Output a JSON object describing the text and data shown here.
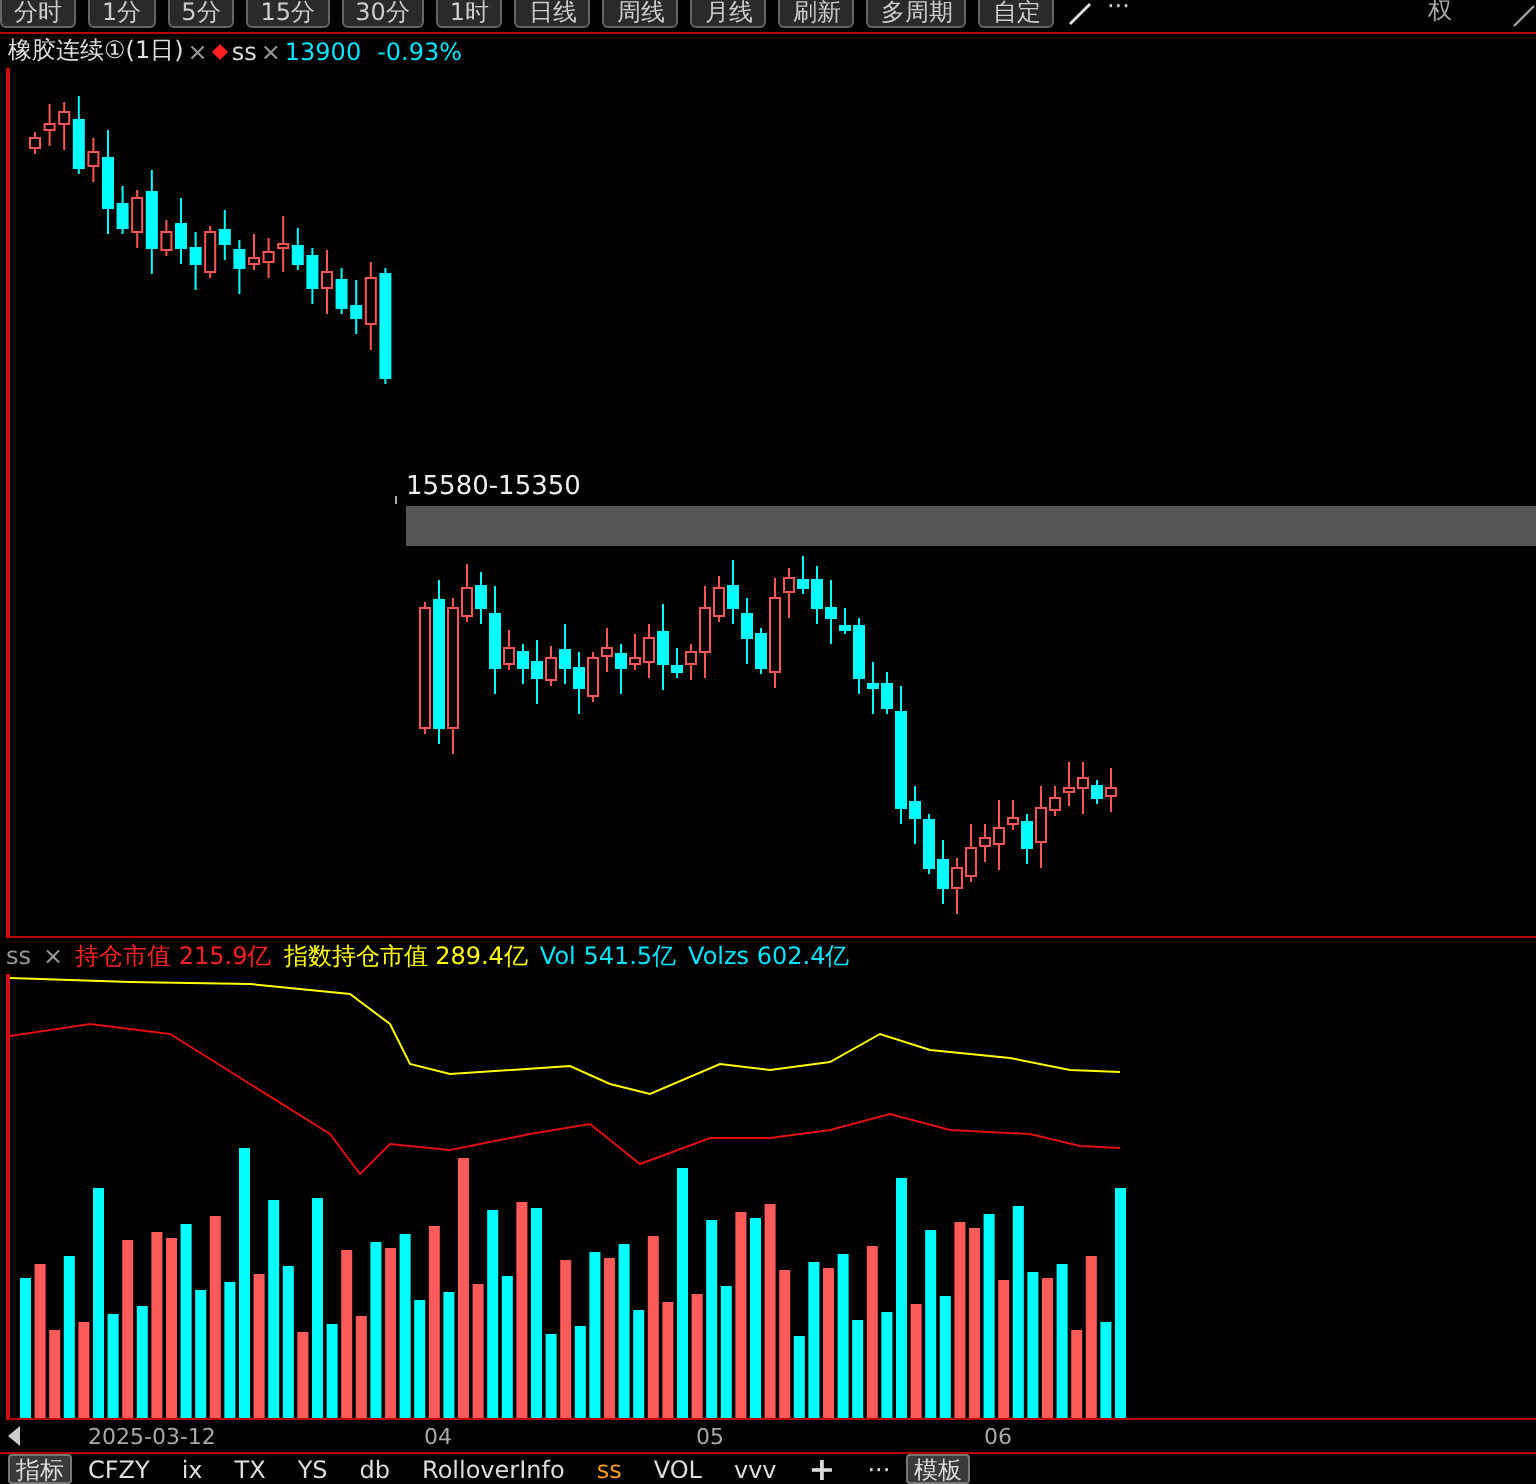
{
  "toolbar": {
    "buttons": [
      {
        "label": "分时"
      },
      {
        "label": "1分"
      },
      {
        "label": "5分"
      },
      {
        "label": "15分"
      },
      {
        "label": "30分"
      },
      {
        "label": "1时"
      },
      {
        "label": "日线"
      },
      {
        "label": "周线"
      },
      {
        "label": "月线"
      },
      {
        "label": "刷新"
      },
      {
        "label": "多周期"
      },
      {
        "label": "自定"
      }
    ],
    "more": "···",
    "right_label": "权"
  },
  "title": {
    "instrument": "橡胶连续①(1日)",
    "separator": "×",
    "series": "ss",
    "separator_2": "×",
    "price": "13900",
    "change": "-0.93%"
  },
  "zone": {
    "label": "15580-15350"
  },
  "indicator": {
    "name": "ss",
    "separator": "×",
    "items": [
      {
        "label": "持仓市值 215.9亿",
        "color": "#ff2020"
      },
      {
        "label": "指数持仓市值 289.4亿",
        "color": "#ffff00"
      },
      {
        "label": "Vol 541.5亿",
        "color": "#00e5ff"
      },
      {
        "label": "Volzs 602.4亿",
        "color": "#00e5ff"
      }
    ]
  },
  "axis": {
    "labels": [
      "2025-03-12",
      "04",
      "05",
      "06"
    ]
  },
  "tabs": [
    {
      "label": "指标",
      "kind": "button",
      "selected": false
    },
    {
      "label": "CFZY",
      "kind": "tab",
      "selected": false
    },
    {
      "label": "ix",
      "kind": "tab",
      "selected": false
    },
    {
      "label": "TX",
      "kind": "tab",
      "selected": false
    },
    {
      "label": "YS",
      "kind": "tab",
      "selected": false
    },
    {
      "label": "db",
      "kind": "tab",
      "selected": false
    },
    {
      "label": "RolloverInfo",
      "kind": "tab",
      "selected": false
    },
    {
      "label": "ss",
      "kind": "tab",
      "selected": true
    },
    {
      "label": "VOL",
      "kind": "tab",
      "selected": false
    },
    {
      "label": "vvv",
      "kind": "tab",
      "selected": false
    },
    {
      "label": "+",
      "kind": "add",
      "selected": false
    },
    {
      "label": "···",
      "kind": "more",
      "selected": false
    },
    {
      "label": "模板",
      "kind": "button",
      "selected": false
    }
  ]
}
